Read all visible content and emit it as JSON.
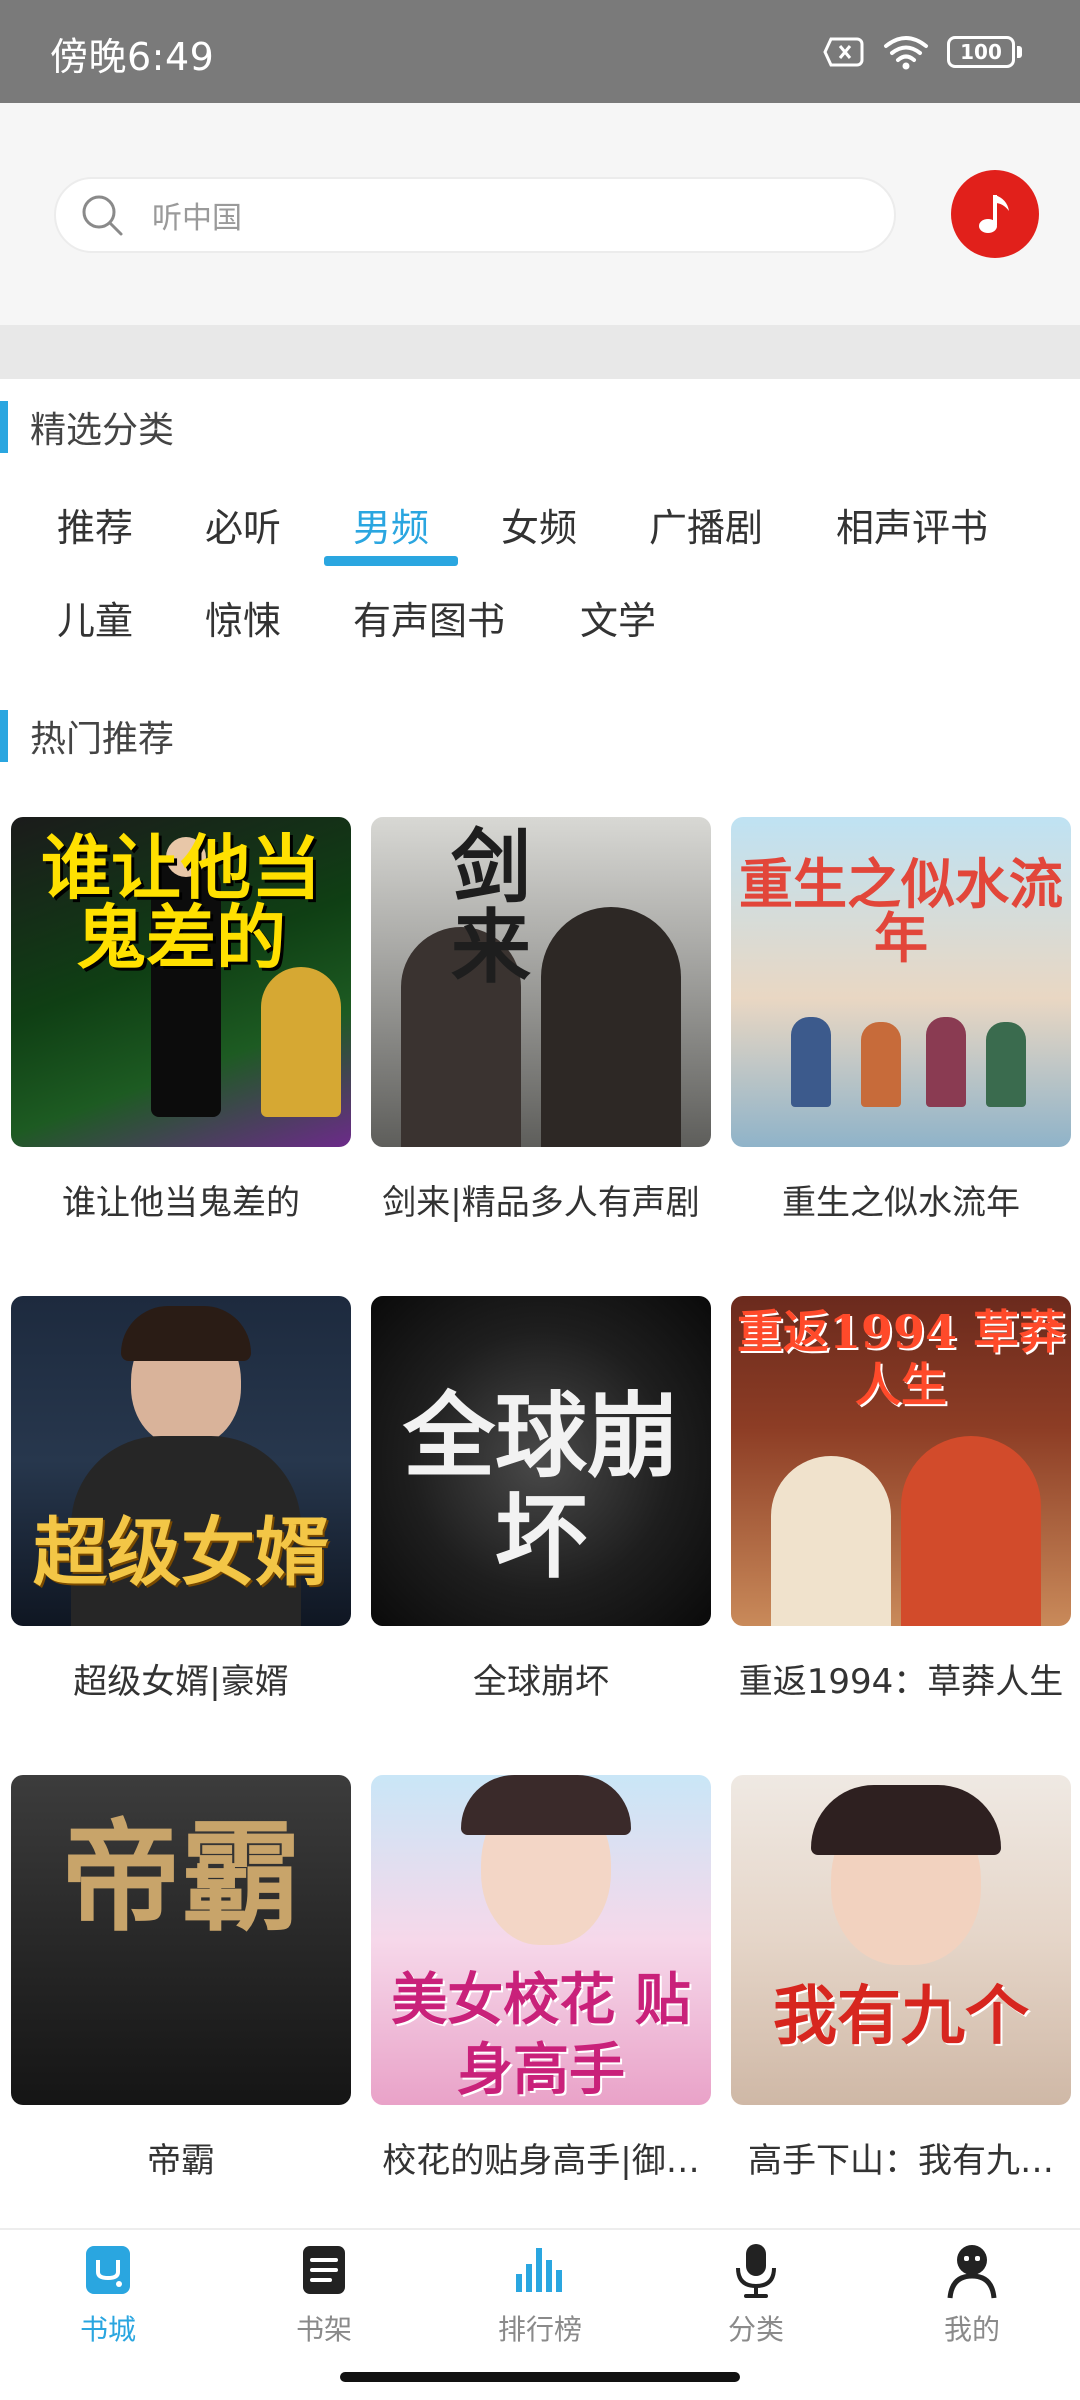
{
  "status_bar": {
    "time": "傍晚6:49",
    "battery": "100",
    "icons": [
      "sim-off-icon",
      "wifi-icon",
      "battery-icon"
    ]
  },
  "search": {
    "placeholder": "听中国"
  },
  "sections": {
    "categories_title": "精选分类",
    "hot_title": "热门推荐"
  },
  "categories": [
    {
      "label": "推荐",
      "active": false
    },
    {
      "label": "必听",
      "active": false
    },
    {
      "label": "男频",
      "active": true
    },
    {
      "label": "女频",
      "active": false
    },
    {
      "label": "广播剧",
      "active": false
    },
    {
      "label": "相声评书",
      "active": false
    },
    {
      "label": "儿童",
      "active": false
    },
    {
      "label": "惊悚",
      "active": false
    },
    {
      "label": "有声图书",
      "active": false
    },
    {
      "label": "文学",
      "active": false
    }
  ],
  "books": [
    {
      "title": "谁让他当鬼差的",
      "cover_text": "谁让他当鬼差的"
    },
    {
      "title": "剑来|精品多人有声剧",
      "cover_text": "剑来"
    },
    {
      "title": "重生之似水流年",
      "cover_text": "重生之似水流年"
    },
    {
      "title": "超级女婿|豪婿",
      "cover_text": "超级女婿"
    },
    {
      "title": "全球崩坏",
      "cover_text": "全球崩坏"
    },
    {
      "title": "重返1994：草莽人生",
      "cover_text": "重返1994 草莽人生"
    },
    {
      "title": "帝霸",
      "cover_text": "帝霸"
    },
    {
      "title": "校花的贴身高手|御…",
      "cover_text": "美女校花 贴身高手"
    },
    {
      "title": "高手下山：我有九…",
      "cover_text": "我有九个"
    }
  ],
  "bottom_nav": [
    {
      "label": "书城",
      "icon": "bookstore-icon",
      "active": true
    },
    {
      "label": "书架",
      "icon": "bookshelf-icon",
      "active": false
    },
    {
      "label": "排行榜",
      "icon": "ranking-icon",
      "active": false
    },
    {
      "label": "分类",
      "icon": "microphone-icon",
      "active": false
    },
    {
      "label": "我的",
      "icon": "profile-icon",
      "active": false
    }
  ],
  "colors": {
    "accent": "#2aa6e0",
    "music_button": "#e1201b",
    "status_bar": "#7a7a7a"
  }
}
